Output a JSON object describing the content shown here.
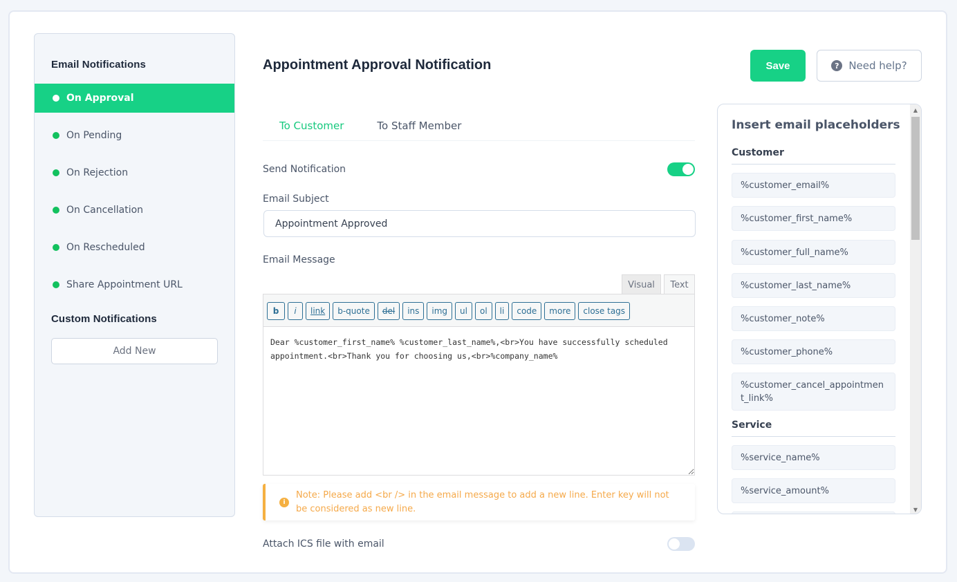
{
  "sidebar": {
    "email_title": "Email Notifications",
    "items": [
      {
        "label": "On Approval",
        "active": true
      },
      {
        "label": "On Pending",
        "active": false
      },
      {
        "label": "On Rejection",
        "active": false
      },
      {
        "label": "On Cancellation",
        "active": false
      },
      {
        "label": "On Rescheduled",
        "active": false
      },
      {
        "label": "Share Appointment URL",
        "active": false
      }
    ],
    "custom_title": "Custom Notifications",
    "add_new_label": "Add New"
  },
  "header": {
    "title": "Appointment Approval Notification",
    "save_label": "Save",
    "help_label": "Need help?",
    "help_icon": "?"
  },
  "tabs": [
    {
      "label": "To Customer",
      "active": true
    },
    {
      "label": "To Staff Member",
      "active": false
    }
  ],
  "form": {
    "send_notification_label": "Send Notification",
    "send_notification_on": true,
    "subject_label": "Email Subject",
    "subject_value": "Appointment Approved",
    "message_label": "Email Message",
    "editor_tabs": {
      "visual": "Visual",
      "text": "Text",
      "active": "Text"
    },
    "toolbar_buttons": [
      "b",
      "i",
      "link",
      "b-quote",
      "del",
      "ins",
      "img",
      "ul",
      "ol",
      "li",
      "code",
      "more",
      "close tags"
    ],
    "message_value": "Dear %customer_first_name% %customer_last_name%,<br>You have successfully scheduled appointment.<br>Thank you for choosing us,<br>%company_name%",
    "note_icon": "i",
    "note": "Note: Please add <br /> in the email message to add a new line. Enter key will not be considered as new line.",
    "attach_ics_label": "Attach ICS file with email",
    "attach_ics_on": false
  },
  "placeholders": {
    "title": "Insert email placeholders",
    "groups": [
      {
        "name": "Customer",
        "items": [
          "%customer_email%",
          "%customer_first_name%",
          "%customer_full_name%",
          "%customer_last_name%",
          "%customer_note%",
          "%customer_phone%",
          "%customer_cancel_appointment_link%"
        ]
      },
      {
        "name": "Service",
        "items": [
          "%service_name%",
          "%service_amount%"
        ]
      }
    ]
  },
  "colors": {
    "accent": "#17d186",
    "status_dot": "#12c15e",
    "warning": "#f5b041",
    "link_blue": "#2d6f95"
  }
}
